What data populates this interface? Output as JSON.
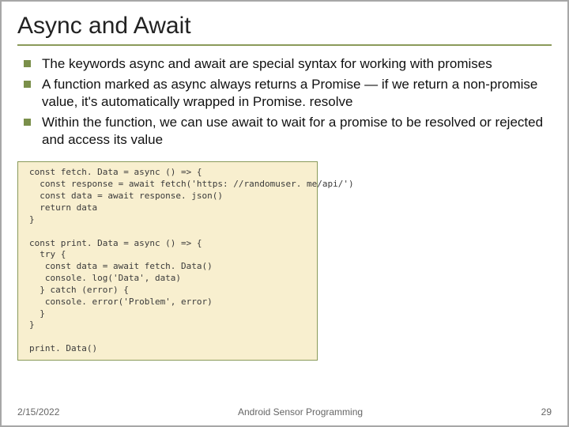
{
  "title": "Async and Await",
  "bullets": [
    "The keywords async and await are special syntax for working with promises",
    "A function marked as async always returns a Promise — if we return a non-promise value, it's automatically wrapped in Promise. resolve",
    "Within the function, we can use await to wait for a promise to be resolved or rejected and access its value"
  ],
  "code": "const fetch. Data = async () => {\n  const response = await fetch('https: //randomuser. me/api/')\n  const data = await response. json()\n  return data\n}\n\nconst print. Data = async () => {\n  try {\n   const data = await fetch. Data()\n   console. log('Data', data)\n  } catch (error) {\n   console. error('Problem', error)\n  }\n}\n\nprint. Data()",
  "footer": {
    "date": "2/15/2022",
    "course": "Android Sensor Programming",
    "page": "29"
  }
}
